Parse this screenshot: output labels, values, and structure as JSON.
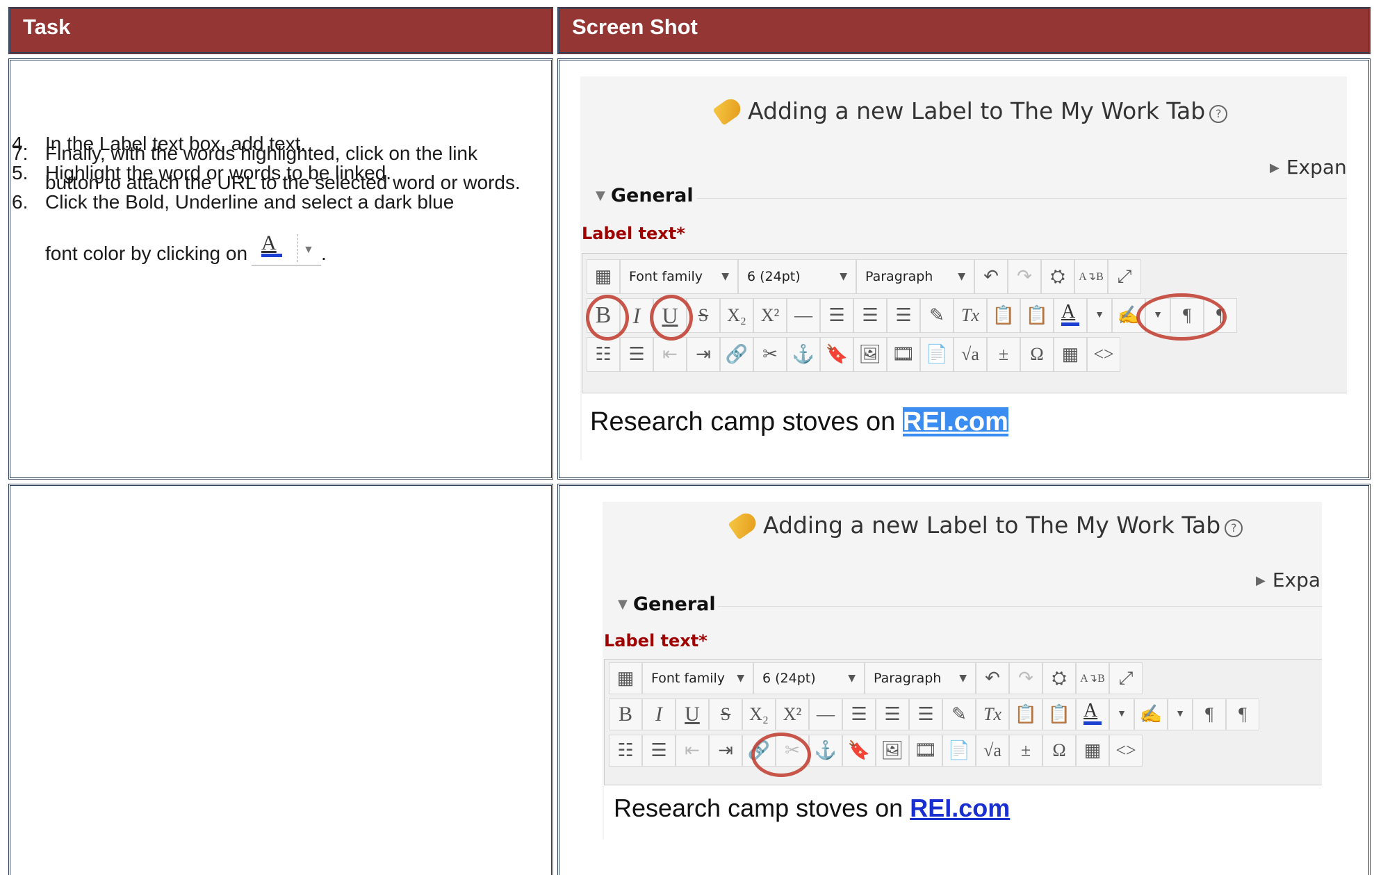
{
  "headers": {
    "task": "Task",
    "screenshot": "Screen Shot"
  },
  "steps_row1": [
    {
      "num": "4.",
      "text": "In the Label text box, add text."
    },
    {
      "num": "5.",
      "text": "Highlight the word or words to be linked."
    },
    {
      "num": "6.",
      "text": "Click the Bold, Underline and select a dark blue",
      "text2": "font color by clicking on",
      "text3": "."
    }
  ],
  "steps_row2": [
    {
      "num": "7.",
      "text": "Finally, with the words highlighted, click on the link button to attach the URL to the selected word or words."
    }
  ],
  "form": {
    "title": "Adding a new Label to The My Work Tab",
    "help_icon": "?",
    "expand_row1": "Expan",
    "expand_row2": "Expar",
    "section": "General",
    "label_text": "Label text*"
  },
  "toolbar": {
    "font_family": "Font family",
    "font_size": "6 (24pt)",
    "paragraph": "Paragraph",
    "bold": "B",
    "italic": "I",
    "underline": "U",
    "strike": "S",
    "subscript": "X₂",
    "superscript": "X²",
    "hr": "—",
    "align_left": "☰",
    "align_center": "☰",
    "align_right": "☰",
    "clear_format": "Tx",
    "omega": "Ω",
    "code": "<>",
    "ltr": "¶",
    "rtl": "¶",
    "sqrt": "√a",
    "text_color_glyph": "A"
  },
  "editor_content": {
    "prefix": "Research camp stoves on ",
    "link": "REI.com"
  },
  "colors": {
    "header_bg": "#943634",
    "highlight": "#3b8cf0",
    "link": "#1a2fd0",
    "label_text": "#a00000",
    "circle": "#c0392b"
  }
}
